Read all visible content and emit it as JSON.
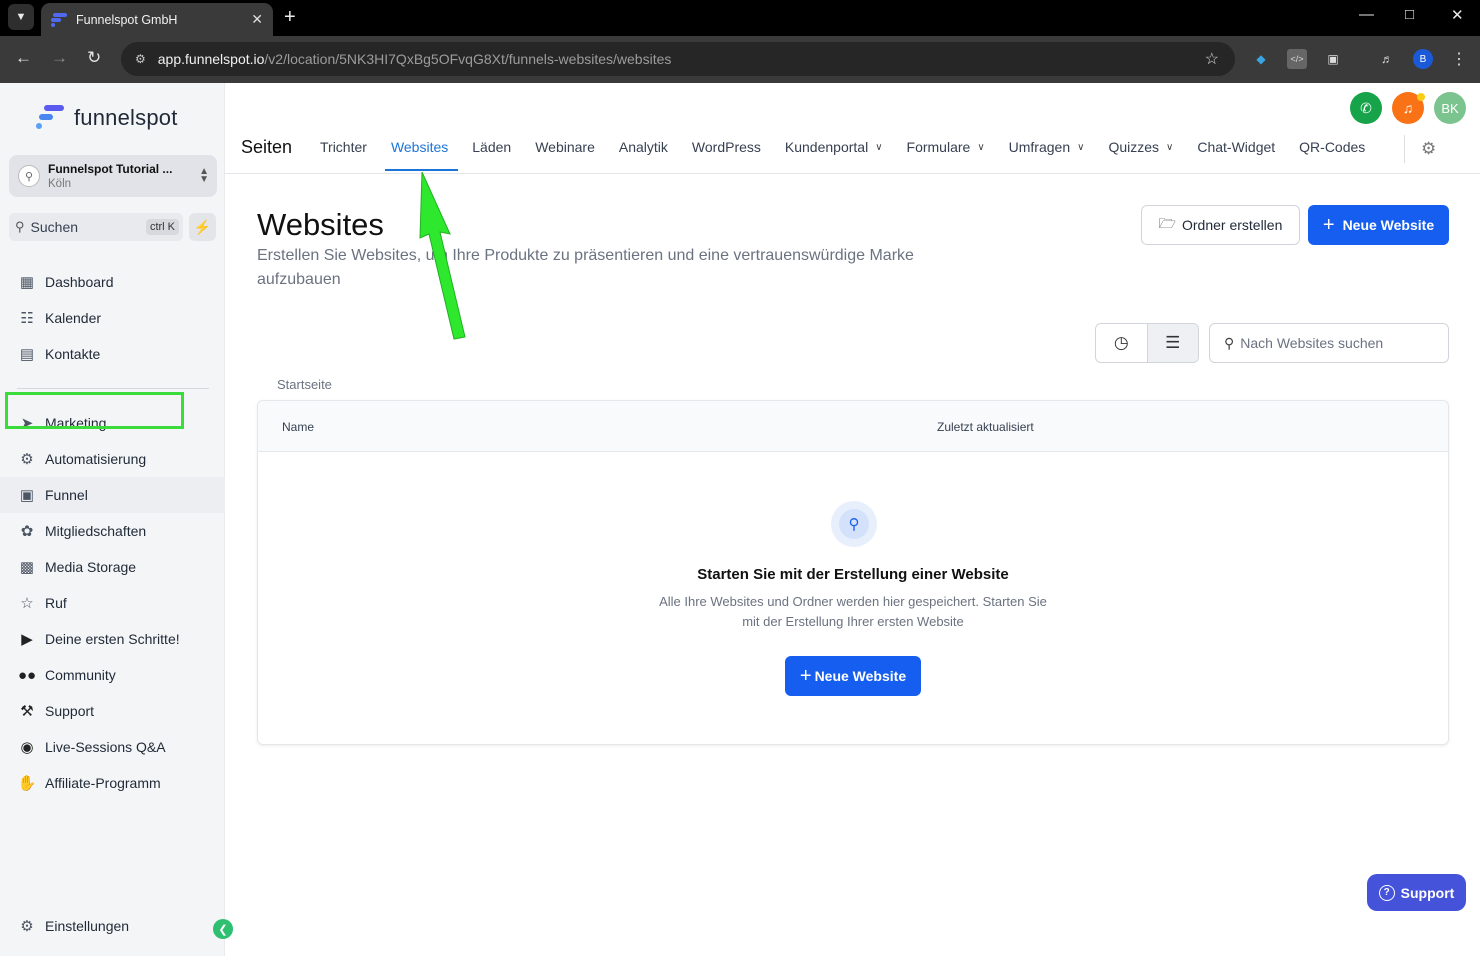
{
  "browser": {
    "tab_title": "Funnelspot GmbH",
    "url_host": "app.funnelspot.io",
    "url_path": "/v2/location/5NK3HI7QxBg5OFvqG8Xt/funnels-websites/websites",
    "profile_initial": "B"
  },
  "sidebar": {
    "logo_text": "funnelspot",
    "account_name": "Funnelspot Tutorial ...",
    "account_location": "Köln",
    "search_label": "Suchen",
    "search_shortcut": "ctrl K",
    "items": [
      {
        "label": "Dashboard",
        "icon": "dashboard-icon"
      },
      {
        "label": "Kalender",
        "icon": "calendar-icon"
      },
      {
        "label": "Kontakte",
        "icon": "contacts-icon"
      },
      {
        "label": "Marketing",
        "icon": "send-icon"
      },
      {
        "label": "Automatisierung",
        "icon": "automation-icon"
      },
      {
        "label": "Funnel",
        "icon": "funnel-icon"
      },
      {
        "label": "Mitgliedschaften",
        "icon": "badge-icon"
      },
      {
        "label": "Media Storage",
        "icon": "image-icon"
      },
      {
        "label": "Ruf",
        "icon": "star-icon"
      },
      {
        "label": "Deine ersten Schritte!",
        "icon": "play-icon"
      },
      {
        "label": "Community",
        "icon": "users-icon"
      },
      {
        "label": "Support",
        "icon": "wrench-icon"
      },
      {
        "label": "Live-Sessions Q&A",
        "icon": "chat-icon"
      },
      {
        "label": "Affiliate-Programm",
        "icon": "hand-icon"
      }
    ],
    "settings_label": "Einstellungen"
  },
  "topnav": {
    "section": "Seiten",
    "user_initials": "BK",
    "tabs": [
      {
        "label": "Trichter",
        "dropdown": false
      },
      {
        "label": "Websites",
        "dropdown": false,
        "active": true
      },
      {
        "label": "Läden",
        "dropdown": false
      },
      {
        "label": "Webinare",
        "dropdown": false
      },
      {
        "label": "Analytik",
        "dropdown": false
      },
      {
        "label": "WordPress",
        "dropdown": false
      },
      {
        "label": "Kundenportal",
        "dropdown": true
      },
      {
        "label": "Formulare",
        "dropdown": true
      },
      {
        "label": "Umfragen",
        "dropdown": true
      },
      {
        "label": "Quizzes",
        "dropdown": true
      },
      {
        "label": "Chat-Widget",
        "dropdown": false
      },
      {
        "label": "QR-Codes",
        "dropdown": false
      }
    ]
  },
  "main": {
    "title": "Websites",
    "subtitle": "Erstellen Sie Websites, um Ihre Produkte zu präsentieren und eine vertrauenswürdige Marke aufzubauen",
    "create_folder_label": "Ordner erstellen",
    "new_website_label": "Neue Website",
    "search_placeholder": "Nach Websites suchen",
    "breadcrumb": "Startseite",
    "table": {
      "col_name": "Name",
      "col_updated": "Zuletzt aktualisiert"
    },
    "empty": {
      "title": "Starten Sie mit der Erstellung einer Website",
      "text": "Alle Ihre Websites und Ordner werden hier gespeichert. Starten Sie mit der Erstellung Ihrer ersten Website",
      "button_label": "Neue Website"
    }
  },
  "support_label": "Support",
  "colors": {
    "primary": "#155eef",
    "active_tab": "#1d74d8",
    "annotation_green": "#3cdb3c"
  }
}
